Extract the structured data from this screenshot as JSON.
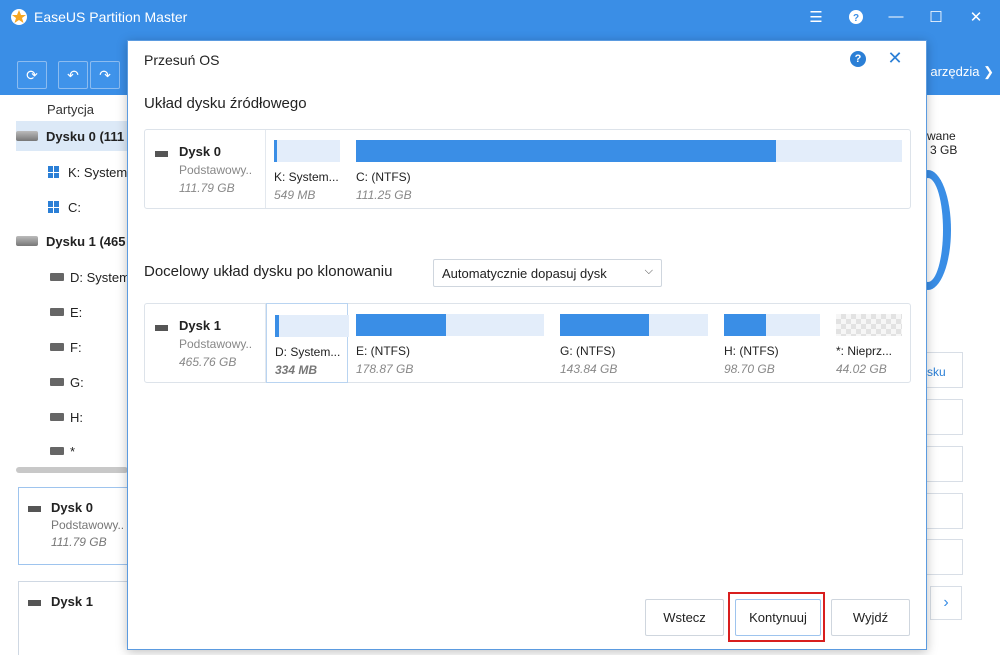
{
  "app": {
    "title": "EaseUS Partition Master",
    "tools_label": "arzędzia"
  },
  "left_pane": {
    "header": "Partycja",
    "rows": [
      {
        "label": "Dysku 0 (111",
        "type": "disk"
      },
      {
        "label": "K: System",
        "type": "win"
      },
      {
        "label": "C:",
        "type": "win"
      },
      {
        "label": "Dysku 1 (465",
        "type": "disk"
      },
      {
        "label": "D: System",
        "type": "part"
      },
      {
        "label": "E:",
        "type": "part"
      },
      {
        "label": "F:",
        "type": "part"
      },
      {
        "label": "G:",
        "type": "part"
      },
      {
        "label": "H:",
        "type": "part"
      },
      {
        "label": "*",
        "type": "part"
      }
    ],
    "cards": [
      {
        "name": "Dysk 0",
        "sub": "Podstawowy..",
        "size": "111.79 GB"
      },
      {
        "name": "Dysk 1",
        "sub": "",
        "size": ""
      }
    ]
  },
  "right_pane": {
    "line1": "wane",
    "line2": "3 GB",
    "button_text": "sku"
  },
  "dialog": {
    "title": "Przesuń OS",
    "source_title": "Układ dysku źródłowego",
    "target_title": "Docelowy układ dysku po klonowaniu",
    "target_mode": "Automatycznie dopasuj dysk",
    "source_disk": {
      "name": "Dysk 0",
      "sub": "Podstawowy..",
      "size": "111.79 GB"
    },
    "source_parts": [
      {
        "label": "K: System...",
        "size": "549 MB",
        "fill": 0.05
      },
      {
        "label": "C:  (NTFS)",
        "size": "111.25 GB",
        "fill": 0.77
      }
    ],
    "target_disk": {
      "name": "Dysk 1",
      "sub": "Podstawowy..",
      "size": "465.76 GB"
    },
    "target_parts": [
      {
        "label": "D: System...",
        "size": "334 MB",
        "fill": 0.06
      },
      {
        "label": "E:  (NTFS)",
        "size": "178.87 GB",
        "fill": 0.48
      },
      {
        "label": "G:  (NTFS)",
        "size": "143.84 GB",
        "fill": 0.6
      },
      {
        "label": "H:  (NTFS)",
        "size": "98.70 GB",
        "fill": 0.44
      },
      {
        "label": "*: Nieprz...",
        "size": "44.02 GB",
        "fill": 0
      }
    ],
    "buttons": {
      "back": "Wstecz",
      "continue": "Kontynuuj",
      "exit": "Wyjdź"
    }
  },
  "colors": {
    "accent": "#3a8ee6",
    "highlight": "#d81e1e"
  }
}
